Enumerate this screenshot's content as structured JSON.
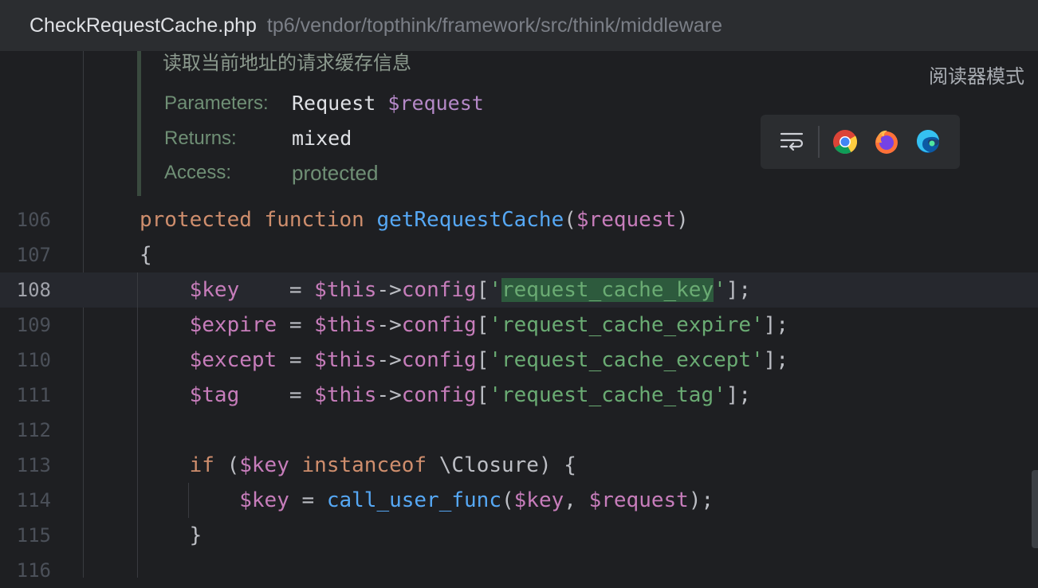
{
  "titlebar": {
    "filename": "CheckRequestCache.php",
    "path": "tp6/vendor/topthink/framework/src/think/middleware"
  },
  "doc": {
    "summary": "读取当前地址的请求缓存信息",
    "parameters_label": "Parameters:",
    "parameters_type": "Request",
    "parameters_var": "$request",
    "returns_label": "Returns:",
    "returns_value": "mixed",
    "access_label": "Access:",
    "access_value": "protected"
  },
  "reader_mode": "阅读器模式",
  "toolbar": {
    "icons": [
      "soft-wrap-icon",
      "chrome-icon",
      "firefox-icon",
      "edge-icon"
    ]
  },
  "code_lines": [
    {
      "num": "106",
      "tokens": [
        [
          "kw",
          "protected"
        ],
        [
          "punc",
          " "
        ],
        [
          "kw",
          "function"
        ],
        [
          "punc",
          " "
        ],
        [
          "fn",
          "getRequestCache"
        ],
        [
          "punc",
          "("
        ],
        [
          "var",
          "$request"
        ],
        [
          "punc",
          ")"
        ]
      ]
    },
    {
      "num": "107",
      "tokens": [
        [
          "punc",
          "{"
        ]
      ]
    },
    {
      "num": "108",
      "tokens": [
        [
          "punc",
          "    "
        ],
        [
          "var",
          "$key"
        ],
        [
          "punc",
          "    = "
        ],
        [
          "var",
          "$this"
        ],
        [
          "punc",
          "->"
        ],
        [
          "prop",
          "config"
        ],
        [
          "punc",
          "["
        ],
        [
          "str",
          "'"
        ],
        [
          "str hl",
          "request_cache_key"
        ],
        [
          "str",
          "'"
        ],
        [
          "punc",
          "];"
        ]
      ]
    },
    {
      "num": "109",
      "tokens": [
        [
          "punc",
          "    "
        ],
        [
          "var",
          "$expire"
        ],
        [
          "punc",
          " = "
        ],
        [
          "var",
          "$this"
        ],
        [
          "punc",
          "->"
        ],
        [
          "prop",
          "config"
        ],
        [
          "punc",
          "["
        ],
        [
          "str",
          "'request_cache_expire'"
        ],
        [
          "punc",
          "];"
        ]
      ]
    },
    {
      "num": "110",
      "tokens": [
        [
          "punc",
          "    "
        ],
        [
          "var",
          "$except"
        ],
        [
          "punc",
          " = "
        ],
        [
          "var",
          "$this"
        ],
        [
          "punc",
          "->"
        ],
        [
          "prop",
          "config"
        ],
        [
          "punc",
          "["
        ],
        [
          "str",
          "'request_cache_except'"
        ],
        [
          "punc",
          "];"
        ]
      ]
    },
    {
      "num": "111",
      "tokens": [
        [
          "punc",
          "    "
        ],
        [
          "var",
          "$tag"
        ],
        [
          "punc",
          "    = "
        ],
        [
          "var",
          "$this"
        ],
        [
          "punc",
          "->"
        ],
        [
          "prop",
          "config"
        ],
        [
          "punc",
          "["
        ],
        [
          "str",
          "'request_cache_tag'"
        ],
        [
          "punc",
          "];"
        ]
      ]
    },
    {
      "num": "112",
      "tokens": []
    },
    {
      "num": "113",
      "tokens": [
        [
          "punc",
          "    "
        ],
        [
          "kw",
          "if"
        ],
        [
          "punc",
          " ("
        ],
        [
          "var",
          "$key"
        ],
        [
          "punc",
          " "
        ],
        [
          "kw",
          "instanceof"
        ],
        [
          "punc",
          " \\Closure) {"
        ]
      ]
    },
    {
      "num": "114",
      "tokens": [
        [
          "punc",
          "        "
        ],
        [
          "var",
          "$key"
        ],
        [
          "punc",
          " = "
        ],
        [
          "fn",
          "call_user_func"
        ],
        [
          "punc",
          "("
        ],
        [
          "var",
          "$key"
        ],
        [
          "punc",
          ", "
        ],
        [
          "var",
          "$request"
        ],
        [
          "punc",
          ");"
        ]
      ]
    },
    {
      "num": "115",
      "tokens": [
        [
          "punc",
          "    }"
        ]
      ]
    },
    {
      "num": "116",
      "tokens": []
    }
  ],
  "current_line": "108"
}
